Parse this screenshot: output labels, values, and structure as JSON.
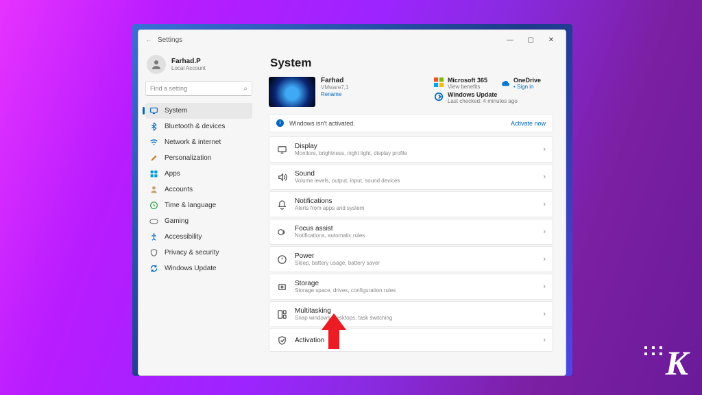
{
  "window": {
    "title": "Settings"
  },
  "user": {
    "name": "Farhad.P",
    "sub": "Local Account"
  },
  "search": {
    "placeholder": "Find a setting"
  },
  "sidebar": {
    "items": [
      {
        "label": "System",
        "icon_color": "#0067c0",
        "glyph": "display",
        "selected": true
      },
      {
        "label": "Bluetooth & devices",
        "icon_color": "#0067c0",
        "glyph": "bt",
        "selected": false
      },
      {
        "label": "Network & internet",
        "icon_color": "#0067c0",
        "glyph": "wifi",
        "selected": false
      },
      {
        "label": "Personalization",
        "icon_color": "#c08030",
        "glyph": "pen",
        "selected": false
      },
      {
        "label": "Apps",
        "icon_color": "#0095d5",
        "glyph": "apps",
        "selected": false
      },
      {
        "label": "Accounts",
        "icon_color": "#c5a070",
        "glyph": "user",
        "selected": false
      },
      {
        "label": "Time & language",
        "icon_color": "#2ea043",
        "glyph": "clock",
        "selected": false
      },
      {
        "label": "Gaming",
        "icon_color": "#7a7a7a",
        "glyph": "game",
        "selected": false
      },
      {
        "label": "Accessibility",
        "icon_color": "#0067c0",
        "glyph": "access",
        "selected": false
      },
      {
        "label": "Privacy & security",
        "icon_color": "#6e6e6e",
        "glyph": "shield",
        "selected": false
      },
      {
        "label": "Windows Update",
        "icon_color": "#0067c0",
        "glyph": "update",
        "selected": false
      }
    ]
  },
  "header": {
    "title": "System"
  },
  "about": {
    "pc_name": "Farhad",
    "pc_vm": "VMware7,1",
    "rename_link": "Rename"
  },
  "tiles": {
    "m365": {
      "title": "Microsoft 365",
      "sub": "View benefits"
    },
    "onedrive": {
      "title": "OneDrive",
      "sub": "Sign in"
    },
    "update": {
      "title": "Windows Update",
      "sub": "Last checked: 4 minutes ago"
    }
  },
  "alert": {
    "text": "Windows isn't activated.",
    "link": "Activate now"
  },
  "cards": [
    {
      "title": "Display",
      "sub": "Monitors, brightness, night light, display profile"
    },
    {
      "title": "Sound",
      "sub": "Volume levels, output, input, sound devices"
    },
    {
      "title": "Notifications",
      "sub": "Alerts from apps and system"
    },
    {
      "title": "Focus assist",
      "sub": "Notifications, automatic rules"
    },
    {
      "title": "Power",
      "sub": "Sleep, battery usage, battery saver"
    },
    {
      "title": "Storage",
      "sub": "Storage space, drives, configuration rules"
    },
    {
      "title": "Multitasking",
      "sub": "Snap windows, desktops, task switching"
    },
    {
      "title": "Activation",
      "sub": ""
    }
  ]
}
